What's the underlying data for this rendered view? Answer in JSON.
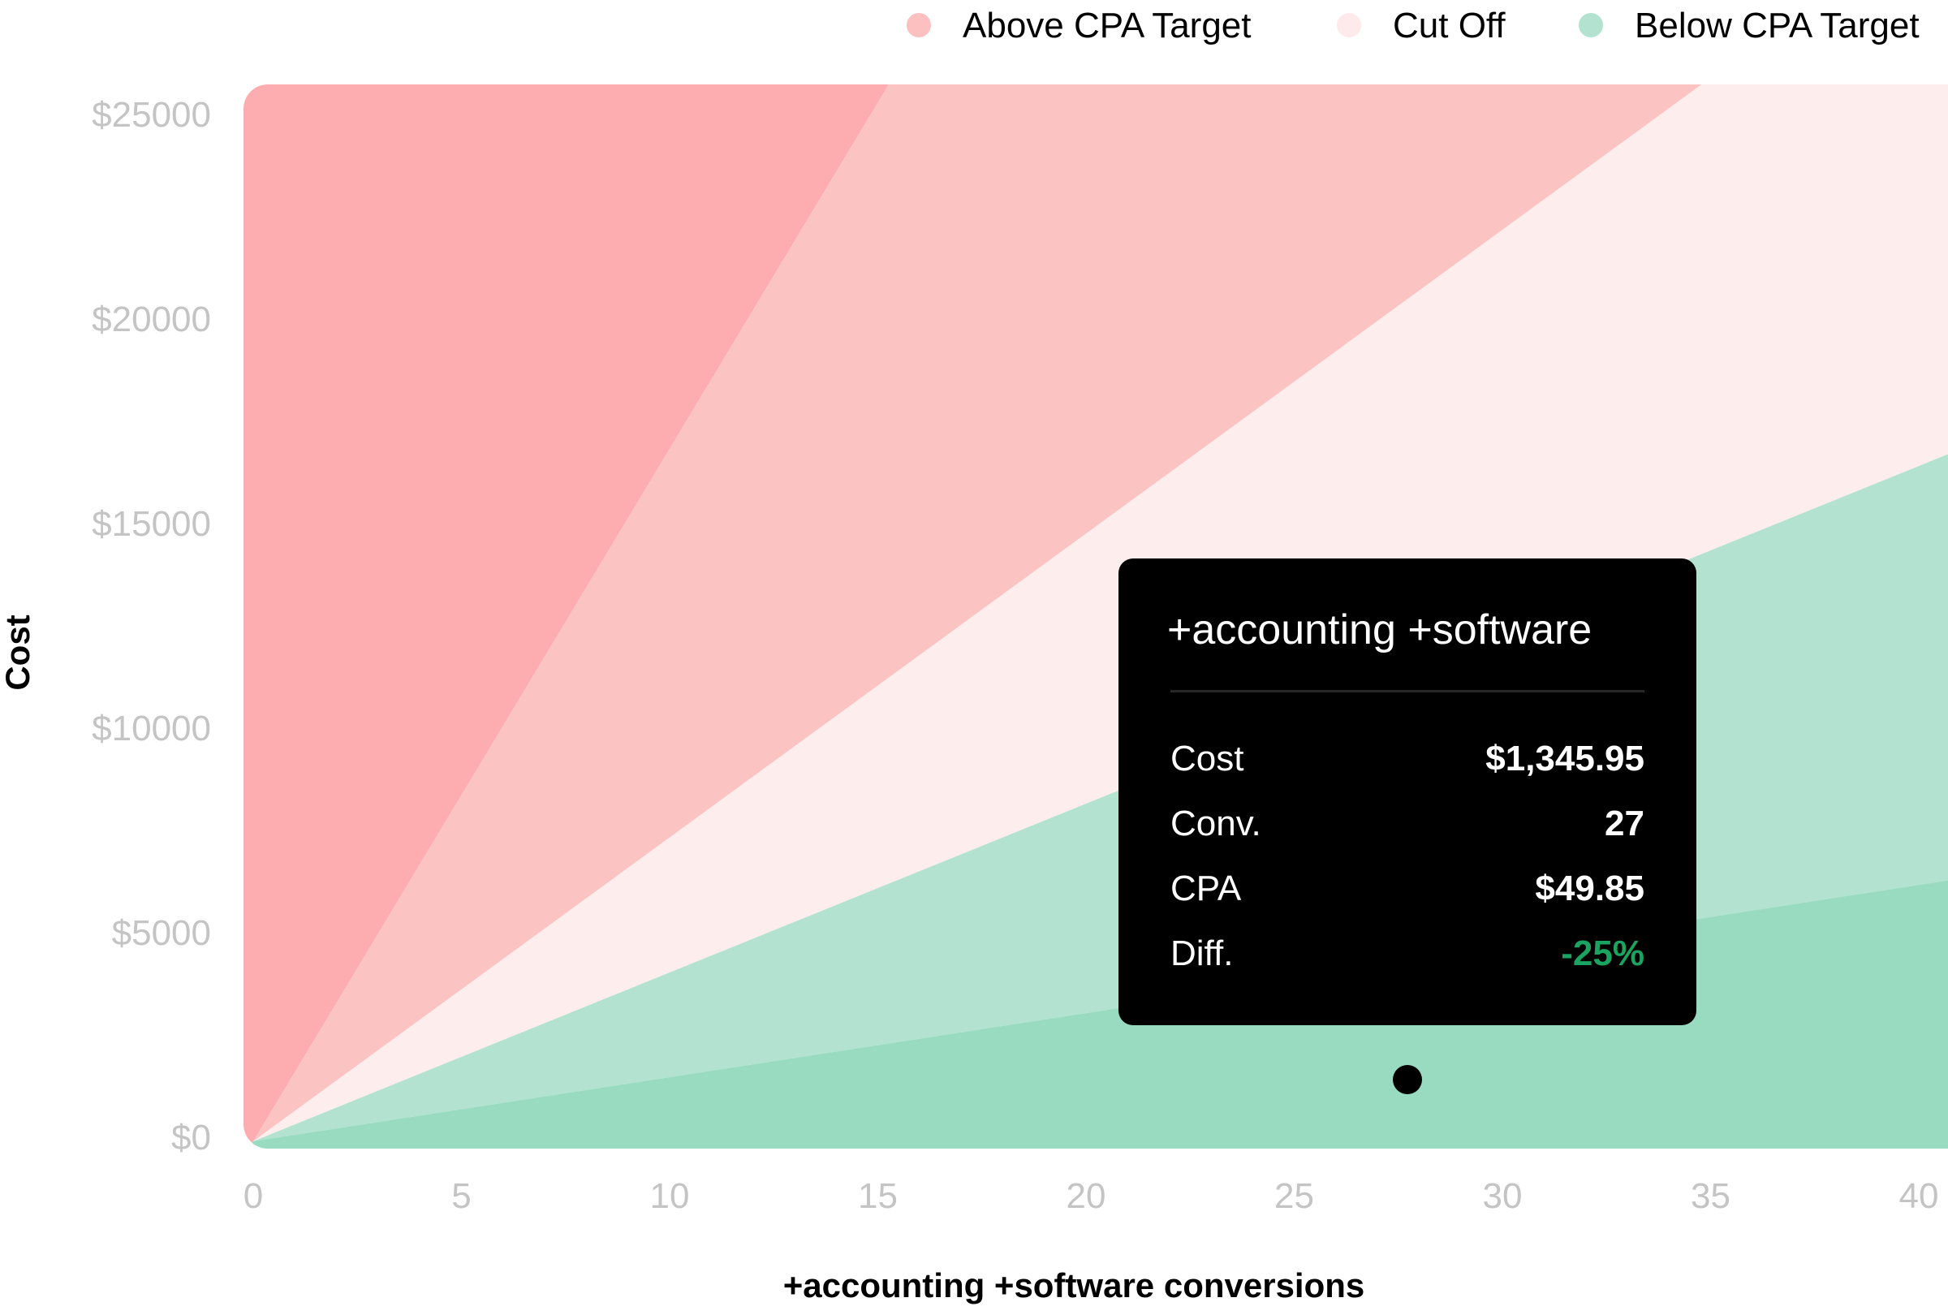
{
  "chart_data": {
    "type": "area",
    "title": "",
    "xlabel": "+accounting +software conversions",
    "ylabel": "Cost",
    "xlim": [
      0,
      40
    ],
    "ylim": [
      0,
      25000
    ],
    "x_ticks": [
      "0",
      "5",
      "10",
      "15",
      "20",
      "25",
      "30",
      "35",
      "40"
    ],
    "x_tick_values": [
      0,
      5,
      10,
      15,
      20,
      25,
      30,
      35,
      40
    ],
    "y_ticks": [
      "$0",
      "$5000",
      "$10000",
      "$15000",
      "$20000",
      "$25000"
    ],
    "y_tick_values": [
      0,
      5000,
      10000,
      15000,
      20000,
      25000
    ],
    "grid": false,
    "legend_position": "top-right",
    "legend": [
      {
        "label": "Above CPA Target",
        "color": "#fcc0c0"
      },
      {
        "label": "Cut Off",
        "color": "#feeaea"
      },
      {
        "label": "Below CPA Target",
        "color": "#b3e3d0"
      }
    ],
    "zones_description": "Wedge regions radiating from origin, bounded by lines of constant CPA (cost per conversion slope in $/conversion)",
    "zones": [
      {
        "name": "Above CPA Target (high)",
        "cpa_from": 1690,
        "cpa_to": null,
        "color": "#fdadaf"
      },
      {
        "name": "Above CPA Target",
        "cpa_from": 740,
        "cpa_to": 1690,
        "color": "#fcc3c3"
      },
      {
        "name": "Cut Off",
        "cpa_from": 410,
        "cpa_to": 740,
        "color": "#feeded"
      },
      {
        "name": "Below CPA Target",
        "cpa_from": 154,
        "cpa_to": 410,
        "color": "#b3e3d0"
      },
      {
        "name": "Below CPA Target (low)",
        "cpa_from": 0,
        "cpa_to": 154,
        "color": "#98dbc0"
      }
    ],
    "points": [
      {
        "label": "+accounting +software",
        "x": 27,
        "y": 1345.95
      }
    ]
  },
  "tooltip": {
    "title": "+accounting +software",
    "rows": [
      {
        "label": "Cost",
        "value": "$1,345.95"
      },
      {
        "label": "Conv.",
        "value": "27"
      },
      {
        "label": "CPA",
        "value": "$49.85"
      },
      {
        "label": "Diff.",
        "value": "-25%",
        "color": "#1aa361"
      }
    ]
  }
}
